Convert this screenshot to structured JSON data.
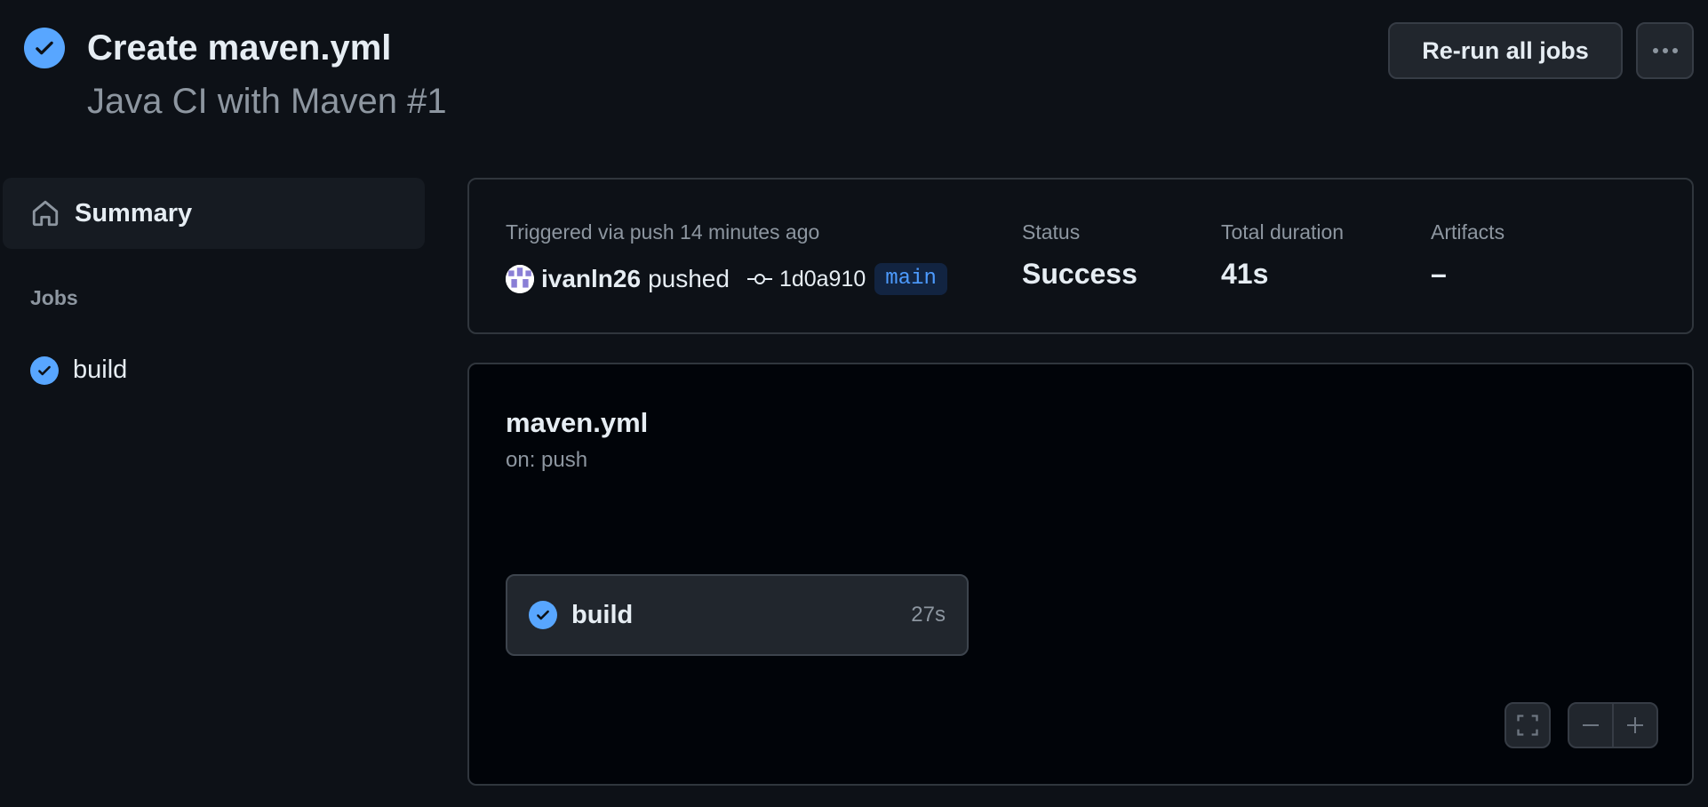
{
  "header": {
    "title": "Create maven.yml",
    "subtitle": "Java CI with Maven #1",
    "rerun_label": "Re-run all jobs"
  },
  "sidebar": {
    "summary_label": "Summary",
    "jobs_heading": "Jobs",
    "jobs": [
      {
        "label": "build",
        "status": "success"
      }
    ]
  },
  "summary": {
    "trigger_text": "Triggered via push 14 minutes ago",
    "actor": "ivanln26",
    "action": "pushed",
    "commit_sha": "1d0a910",
    "branch": "main",
    "status_label": "Status",
    "status_value": "Success",
    "duration_label": "Total duration",
    "duration_value": "41s",
    "artifacts_label": "Artifacts",
    "artifacts_value": "–"
  },
  "graph": {
    "workflow_file": "maven.yml",
    "trigger": "on: push",
    "jobs": [
      {
        "label": "build",
        "duration": "27s",
        "status": "success"
      }
    ]
  },
  "colors": {
    "background": "#0d1117",
    "success_accent": "#58a6ff",
    "branch_text": "#4d9bff",
    "branch_bg": "#122441",
    "muted_text": "#8d96a0"
  }
}
